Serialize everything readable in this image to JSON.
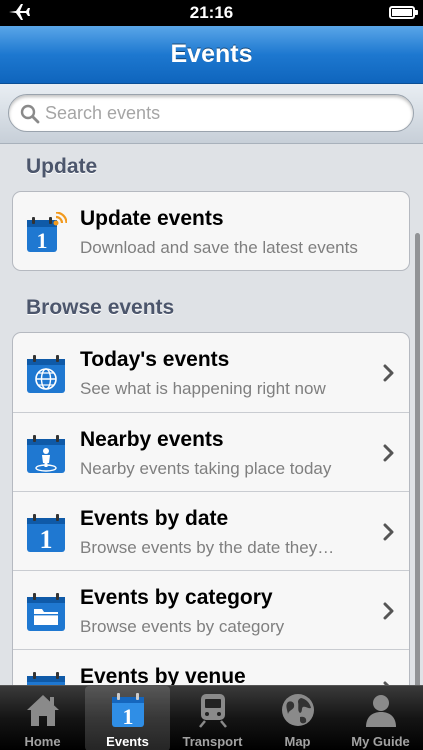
{
  "status_bar": {
    "time": "21:16"
  },
  "navbar": {
    "title": "Events"
  },
  "search": {
    "placeholder": "Search events"
  },
  "sections": {
    "update": {
      "header": "Update",
      "items": [
        {
          "title": "Update events",
          "subtitle": "Download and save the latest events",
          "icon": "calendar-rss-icon"
        }
      ]
    },
    "browse": {
      "header": "Browse events",
      "items": [
        {
          "title": "Today's events",
          "subtitle": "See what is happening right now",
          "icon": "calendar-globe-icon"
        },
        {
          "title": "Nearby events",
          "subtitle": "Nearby events taking place today",
          "icon": "calendar-person-icon"
        },
        {
          "title": "Events by date",
          "subtitle": "Browse events by the date they…",
          "icon": "calendar-date-icon"
        },
        {
          "title": "Events by category",
          "subtitle": "Browse events by category",
          "icon": "calendar-folder-icon"
        },
        {
          "title": "Events by venue",
          "subtitle": "",
          "icon": "calendar-venue-icon"
        }
      ]
    }
  },
  "tabbar": {
    "tabs": [
      {
        "label": "Home",
        "icon": "house-icon"
      },
      {
        "label": "Events",
        "icon": "calendar-icon",
        "active": true
      },
      {
        "label": "Transport",
        "icon": "train-icon"
      },
      {
        "label": "Map",
        "icon": "globe-icon"
      },
      {
        "label": "My Guide",
        "icon": "person-icon"
      }
    ]
  },
  "colors": {
    "navbar": "#1d78d0",
    "section_header": "#4c566c",
    "icon_blue": "#1f78d1"
  }
}
